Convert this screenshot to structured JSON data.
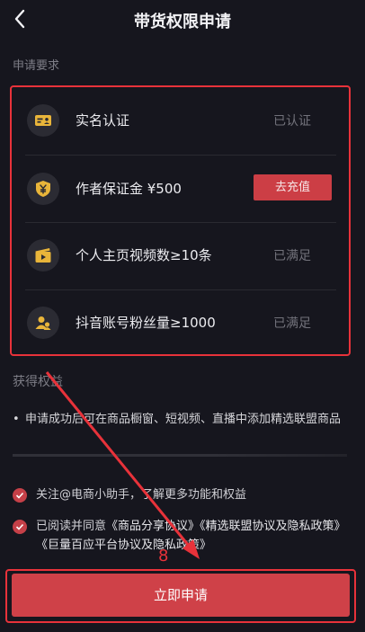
{
  "header": {
    "title": "带货权限申请",
    "back_icon": "chevron-left-icon"
  },
  "requirements": {
    "section_label": "申请要求",
    "items": [
      {
        "icon": "id-card-icon",
        "label": "实名认证",
        "status": "已认证"
      },
      {
        "icon": "shield-yen-icon",
        "label": "作者保证金 ¥500",
        "action": "去充值"
      },
      {
        "icon": "video-clapper-icon",
        "label": "个人主页视频数≥10条",
        "status": "已满足"
      },
      {
        "icon": "users-icon",
        "label": "抖音账号粉丝量≥1000",
        "status": "已满足"
      }
    ]
  },
  "benefits": {
    "section_label": "获得权益",
    "items": [
      "申请成功后可在商品橱窗、短视频、直播中添加精选联盟商品"
    ]
  },
  "options": {
    "follow_text": "关注@电商小助手，了解更多功能和权益",
    "agree_prefix": "已阅读并同意",
    "agree_links": [
      "《商品分享协议》",
      "《精选联盟协议及隐私政策》",
      "《巨量百应平台协议及隐私政策》"
    ]
  },
  "apply_button": "立即申请",
  "annotation": {
    "step_number": "8",
    "color": "#e8323a"
  },
  "colors": {
    "accent": "#cf4148",
    "background": "#16161e",
    "muted": "#72727b"
  }
}
